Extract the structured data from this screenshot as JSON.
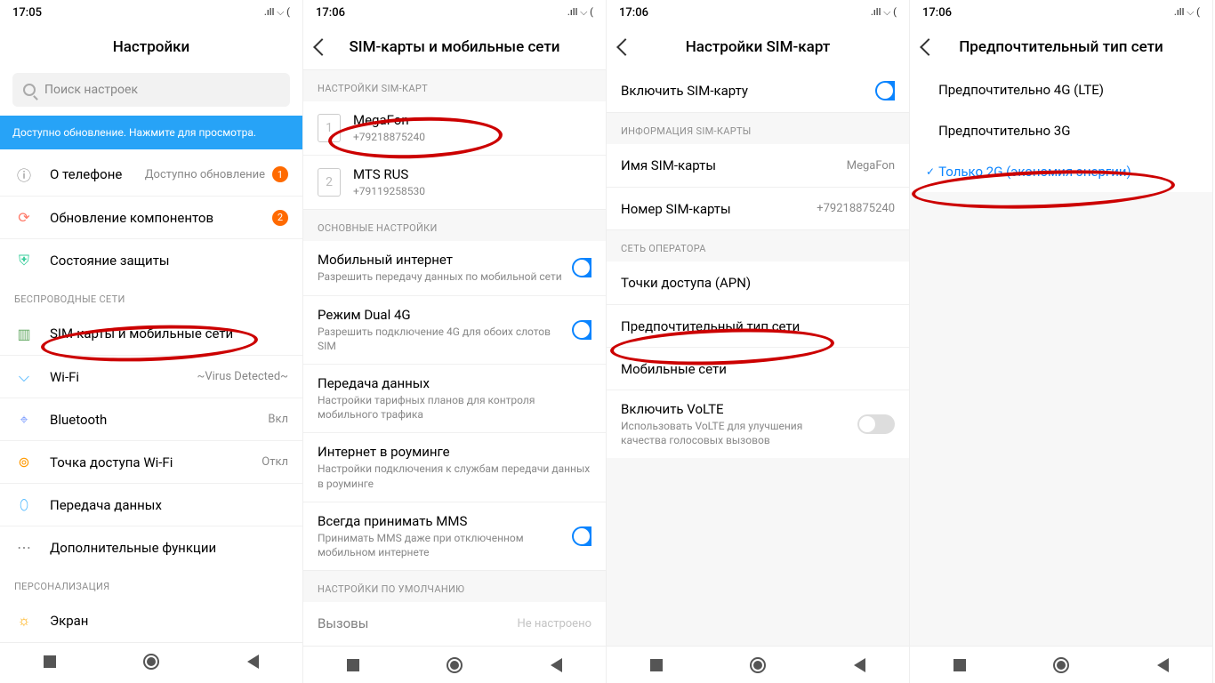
{
  "status": {
    "times": [
      "17:05",
      "17:06",
      "17:06",
      "17:06"
    ],
    "icons_text": ".ıll  ⌵  ("
  },
  "screen1": {
    "title": "Настройки",
    "search_placeholder": "Поиск настроек",
    "update_banner": "Доступно обновление. Нажмите для просмотра.",
    "rows": {
      "about": {
        "label": "О телефоне",
        "right": "Доступно обновление",
        "badge": "1"
      },
      "components": {
        "label": "Обновление компонентов",
        "badge": "2"
      },
      "security": {
        "label": "Состояние защиты"
      }
    },
    "section_wireless": "БЕСПРОВОДНЫЕ СЕТИ",
    "wireless": {
      "sim": {
        "label": "SIM-карты и мобильные сети"
      },
      "wifi": {
        "label": "Wi-Fi",
        "right": "~Virus Detected~"
      },
      "bt": {
        "label": "Bluetooth",
        "right": "Вкл"
      },
      "hotspot": {
        "label": "Точка доступа Wi-Fi",
        "right": "Откл"
      },
      "data": {
        "label": "Передача данных"
      },
      "more": {
        "label": "Дополнительные функции"
      }
    },
    "section_personal": "ПЕРСОНАЛИЗАЦИЯ",
    "display": {
      "label": "Экран"
    }
  },
  "screen2": {
    "title": "SIM-карты и мобильные сети",
    "section_sim": "НАСТРОЙКИ SIM-КАРТ",
    "sim1": {
      "slot": "1",
      "name": "MegaFon",
      "number": "+79218875240"
    },
    "sim2": {
      "slot": "2",
      "name": "MTS RUS",
      "number": "+79119258530"
    },
    "section_main": "ОСНОВНЫЕ НАСТРОЙКИ",
    "mobile_data": {
      "label": "Мобильный интернет",
      "sub": "Разрешить передачу данных по мобильной сети"
    },
    "dual4g": {
      "label": "Режим Dual 4G",
      "sub": "Разрешить подключение 4G для обоих слотов SIM"
    },
    "usage": {
      "label": "Передача данных",
      "sub": "Настройки тарифных планов для контроля мобильного трафика"
    },
    "roaming": {
      "label": "Интернет в роуминге",
      "sub": "Настройки подключения к службам передачи данных в роуминге"
    },
    "mms": {
      "label": "Всегда принимать MMS",
      "sub": "Принимать MMS даже при отключенном мобильном интернете"
    },
    "section_default": "НАСТРОЙКИ ПО УМОЛЧАНИЮ",
    "calls": {
      "label": "Вызовы",
      "right": "Не настроено"
    }
  },
  "screen3": {
    "title": "Настройки SIM-карт",
    "enable": {
      "label": "Включить SIM-карту"
    },
    "section_info": "ИНФОРМАЦИЯ SIM-КАРТЫ",
    "name": {
      "label": "Имя SIM-карты",
      "value": "MegaFon"
    },
    "number": {
      "label": "Номер SIM-карты",
      "value": "+79218875240"
    },
    "section_operator": "СЕТЬ ОПЕРАТОРА",
    "apn": {
      "label": "Точки доступа (APN)"
    },
    "pref": {
      "label": "Предпочтительный тип сети"
    },
    "networks": {
      "label": "Мобильные сети"
    },
    "volte": {
      "label": "Включить VoLTE",
      "sub": "Использовать VoLTE для улучшения качества голосовых вызовов"
    }
  },
  "screen4": {
    "title": "Предпочтительный тип сети",
    "opt1": "Предпочтительно 4G (LTE)",
    "opt2": "Предпочтительно 3G",
    "opt3": "Только 2G (экономия энергии)"
  }
}
